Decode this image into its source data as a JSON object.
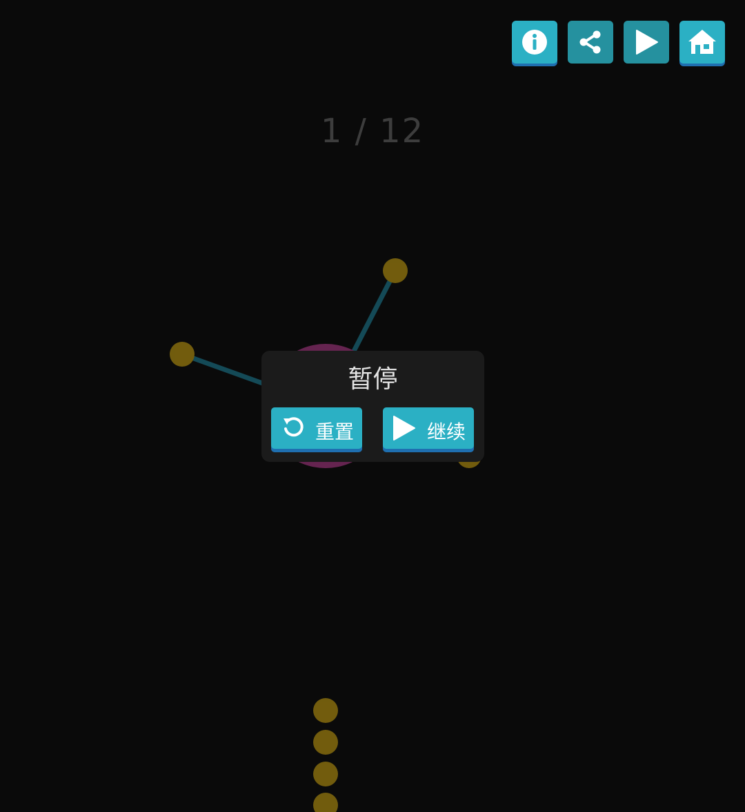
{
  "toolbar": {
    "buttons": [
      {
        "id": "info",
        "icon": "info-icon"
      },
      {
        "id": "share",
        "icon": "share-icon"
      },
      {
        "id": "play",
        "icon": "play-icon"
      },
      {
        "id": "home",
        "icon": "home-icon"
      }
    ]
  },
  "level": {
    "counter": "1 / 12",
    "current": 1,
    "total": 12
  },
  "board": {
    "center_color": "#b03a8a",
    "line_color": "#1d6f82",
    "dot_color": "#9a7a0c",
    "remaining_dots": 4
  },
  "pause_dialog": {
    "title": "暂停",
    "reset_label": "重置",
    "resume_label": "继续",
    "reset_icon": "restart-icon",
    "resume_icon": "play-icon"
  },
  "colors": {
    "background": "#0a0a0a",
    "accent": "#2bb0c4",
    "accent_shadow": "#1f6fb0",
    "dialog_bg": "#1b1b1b"
  }
}
